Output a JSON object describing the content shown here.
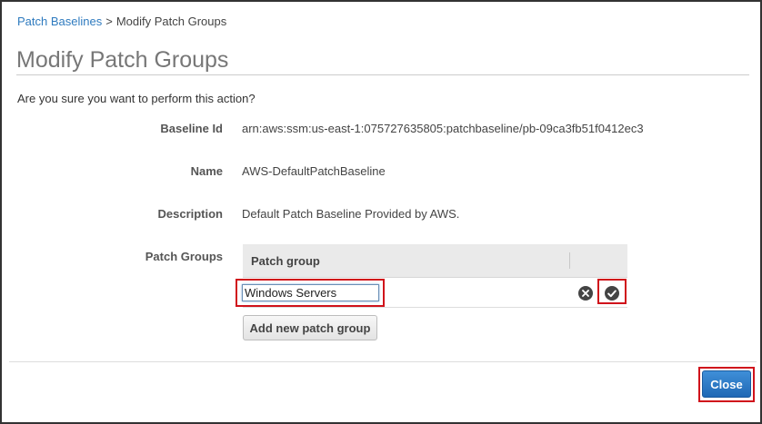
{
  "breadcrumb": {
    "parent": "Patch Baselines",
    "separator": ">",
    "current": "Modify Patch Groups"
  },
  "page_title": "Modify Patch Groups",
  "prompt": "Are you sure you want to perform this action?",
  "fields": {
    "baseline_id": {
      "label": "Baseline Id",
      "value": "arn:aws:ssm:us-east-1:075727635805:patchbaseline/pb-09ca3fb51f0412ec3"
    },
    "name": {
      "label": "Name",
      "value": "AWS-DefaultPatchBaseline"
    },
    "description": {
      "label": "Description",
      "value": "Default Patch Baseline Provided by AWS."
    },
    "patch_groups": {
      "label": "Patch Groups"
    }
  },
  "patch_group_table": {
    "header": "Patch group",
    "row": {
      "value": "Windows Servers"
    }
  },
  "icons": {
    "cancel": "x-circle-icon",
    "confirm": "check-circle-icon"
  },
  "buttons": {
    "add_patch_group": "Add new patch group",
    "close": "Close"
  },
  "colors": {
    "link": "#2f7bbf",
    "primary_button": "#1f68b5",
    "highlight": "#d0121b"
  }
}
